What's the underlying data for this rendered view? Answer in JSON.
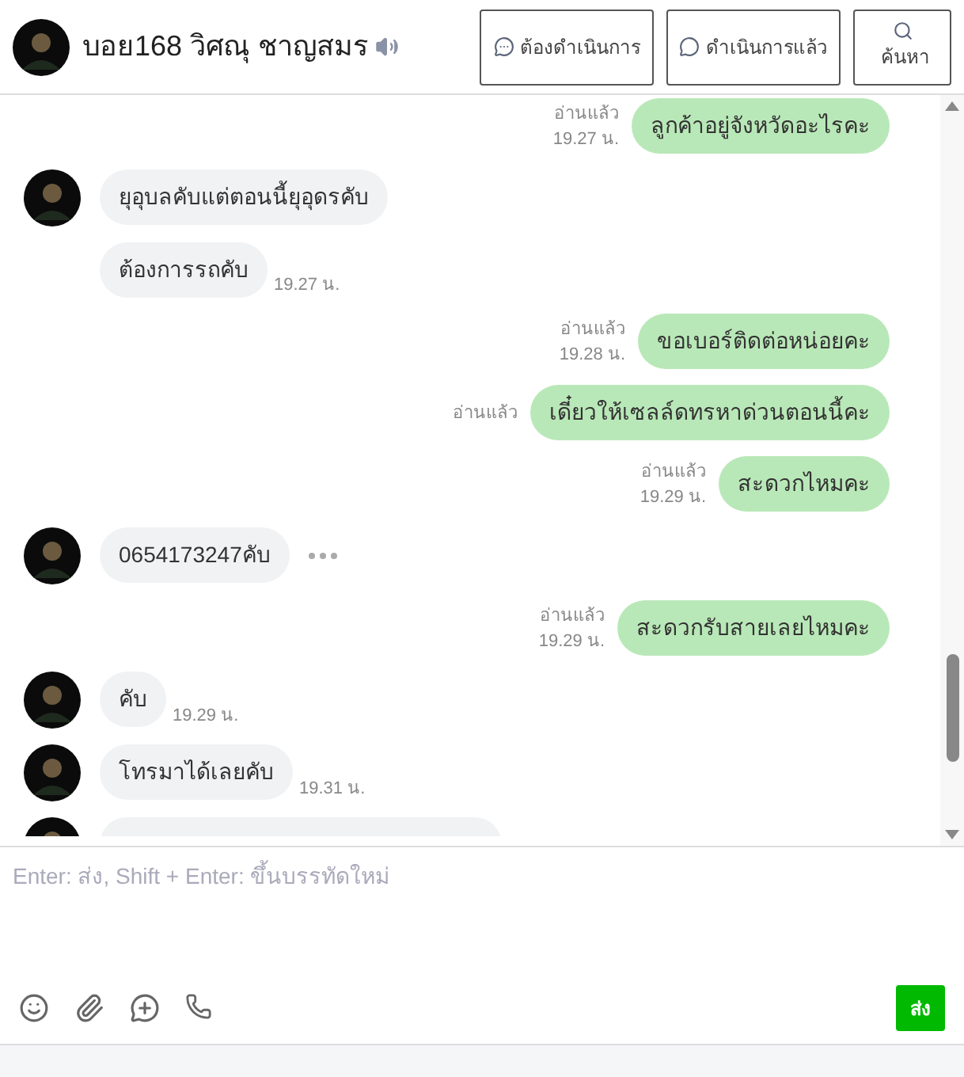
{
  "header": {
    "name": "บอย168 วิศณุ ชาญสมร",
    "buttons": [
      {
        "kind": "pending",
        "label": "ต้องดำเนินการ"
      },
      {
        "kind": "done",
        "label": "ดำเนินการแล้ว"
      },
      {
        "kind": "search",
        "label": "ค้นหา"
      }
    ]
  },
  "messages": [
    {
      "kind": "out",
      "read": "อ่านแล้ว",
      "text": "ลูกค้าอยู่จังหวัดอะไรคะ",
      "time": "19.27 น."
    },
    {
      "kind": "in",
      "avatar": true,
      "text": "ยุอุบลคับแต่ตอนนี้ยุอุดรคับ"
    },
    {
      "kind": "in",
      "avatar": false,
      "text": "ต้องการรถคับ",
      "time": "19.27 น."
    },
    {
      "kind": "out",
      "read": "อ่านแล้ว",
      "text": "ขอเบอร์ติดต่อหน่อยคะ",
      "time": "19.28 น."
    },
    {
      "kind": "out",
      "read": "อ่านแล้ว",
      "text": "เดี๋ยวให้เซลล์ดทรหาด่วนตอนนี้คะ"
    },
    {
      "kind": "out",
      "read": "อ่านแล้ว",
      "text": "สะดวกไหมคะ",
      "time": "19.29 น."
    },
    {
      "kind": "in",
      "avatar": true,
      "text": "0654173247คับ",
      "more": true
    },
    {
      "kind": "out",
      "read": "อ่านแล้ว",
      "text": "สะดวกรับสายเลยไหมคะ",
      "time": "19.29 น."
    },
    {
      "kind": "in",
      "avatar": true,
      "text": "คับ",
      "time": "19.29 น."
    },
    {
      "kind": "in",
      "avatar": true,
      "text": "โทรมาได้เลยคับ",
      "time": "19.31 น."
    },
    {
      "kind": "partial"
    }
  ],
  "composer": {
    "placeholder": "Enter: ส่ง, Shift + Enter: ขึ้นบรรทัดใหม่",
    "send": "ส่ง"
  }
}
